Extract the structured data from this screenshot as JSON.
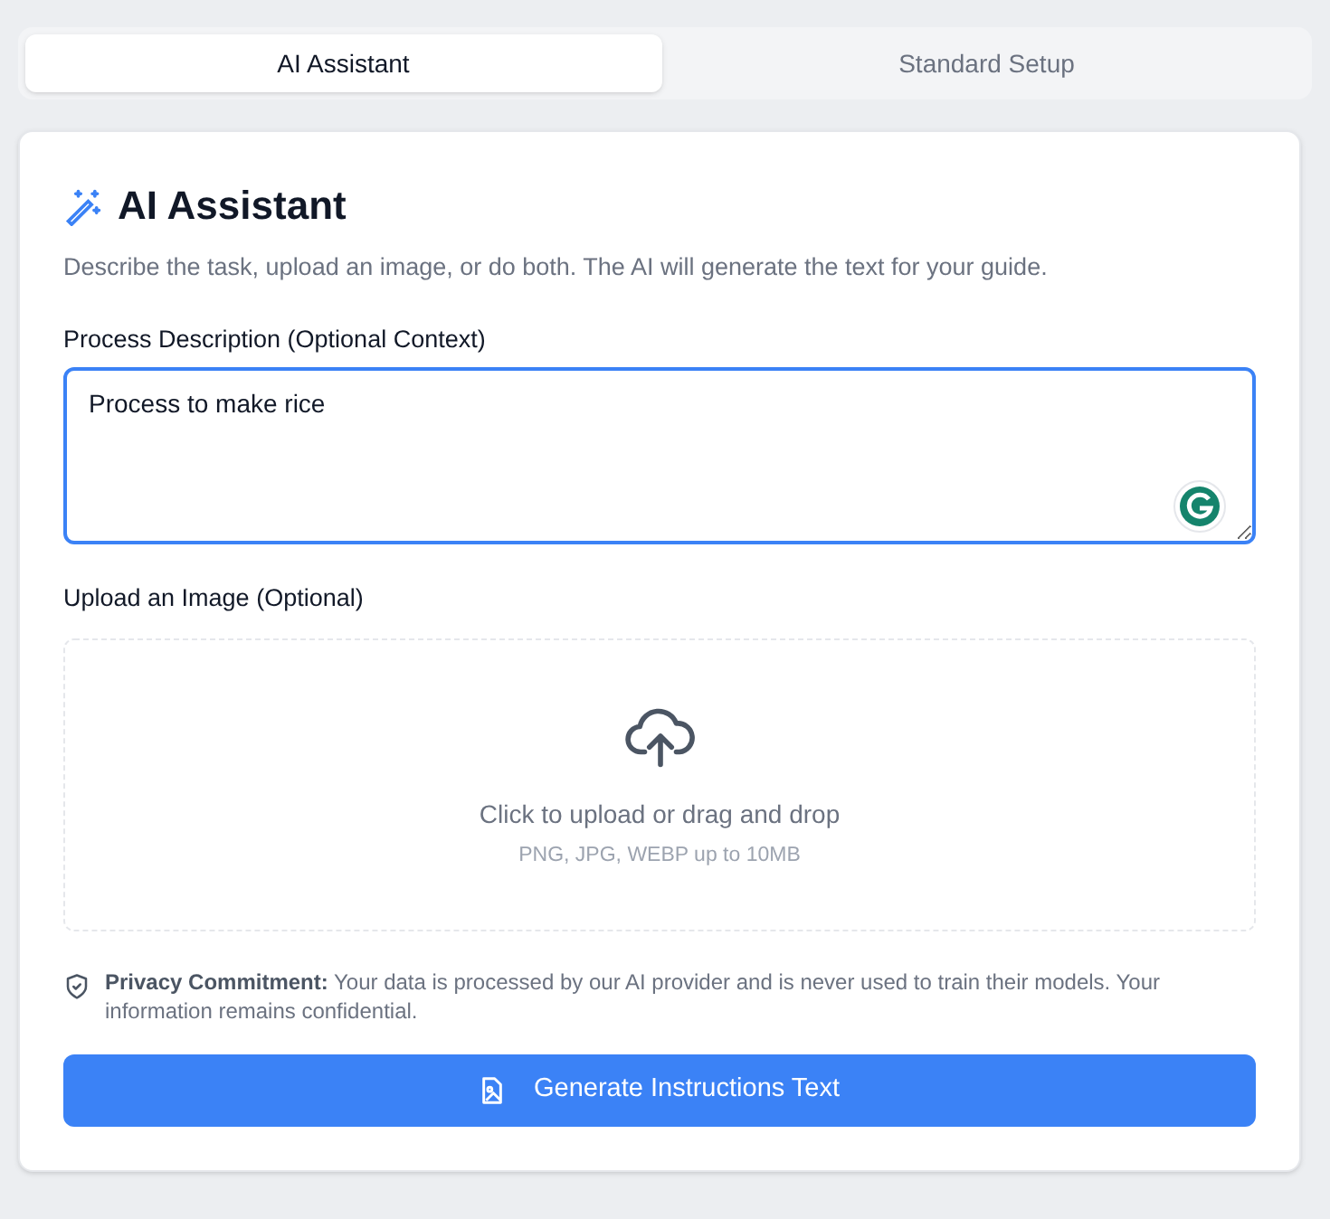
{
  "tabs": [
    {
      "label": "AI Assistant",
      "selected": true
    },
    {
      "label": "Standard Setup",
      "selected": false
    }
  ],
  "card": {
    "title": "AI Assistant",
    "subtitle": "Describe the task, upload an image, or do both. The AI will generate the text for your guide.",
    "description_field": {
      "label": "Process Description (Optional Context)",
      "value": "Process to make rice ",
      "focused": true
    },
    "upload": {
      "label": "Upload an Image (Optional)",
      "prompt": "Click to upload or drag and drop",
      "hint": "PNG, JPG, WEBP up to 10MB"
    },
    "privacy_note": "**Privacy Commitment:** Your data is processed by our AI provider and is never used to train their models. Your information remains confidential.",
    "button": "Generate Instructions Text"
  }
}
